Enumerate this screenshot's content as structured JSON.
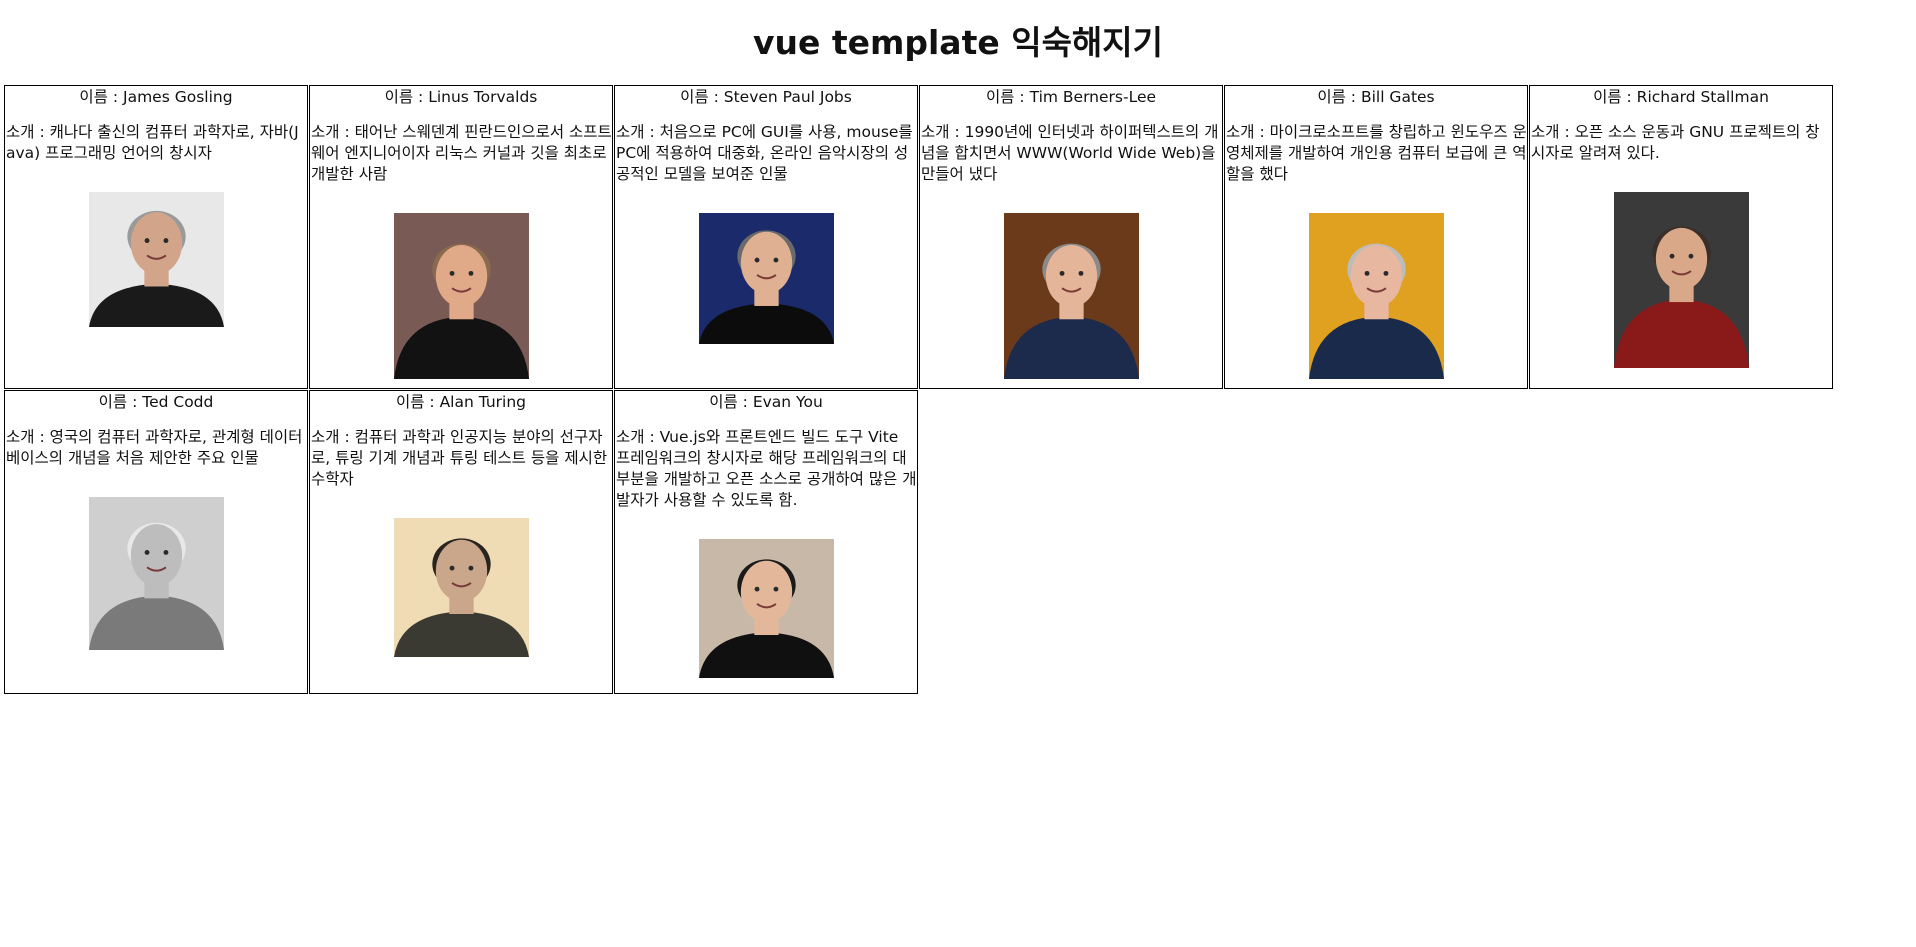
{
  "page": {
    "title": "vue template 익숙해지기"
  },
  "people": [
    {
      "name": "이름 : James Gosling",
      "desc": "소개 : 캐나다 출신의 컴퓨터 과학자로, 자바(Java) 프로그래밍 언어의 창시자",
      "photo": {
        "bg": "#e8e8e8",
        "skin": "#d2a58a",
        "hair": "#9a9a9a",
        "shirt": "#1a1a1a",
        "height_ratio": 1.0
      }
    },
    {
      "name": "이름 : Linus Torvalds",
      "desc": "소개 : 태어난 스웨덴계 핀란드인으로서 소프트웨어 엔지니어이자 리눅스 커널과 깃을 최초로 개발한 사람",
      "photo": {
        "bg": "#7a5a55",
        "skin": "#e0a988",
        "hair": "#8a6a4e",
        "shirt": "#121212",
        "height_ratio": 1.23
      }
    },
    {
      "name": "이름 : Steven Paul Jobs",
      "desc": "소개 : 처음으로 PC에 GUI를 사용, mouse를 PC에 적용하여 대중화, 온라인 음악시장의 성공적인 모델을 보여준 인물",
      "photo": {
        "bg": "#1a2a6a",
        "skin": "#e0b092",
        "hair": "#6a6a6a",
        "shirt": "#0c0c0c",
        "height_ratio": 0.97
      }
    },
    {
      "name": "이름 : Tim Berners-Lee",
      "desc": "소개 : 1990년에 인터넷과 하이퍼텍스트의 개념을 합치면서 WWW(World Wide Web)을 만들어 냈다",
      "photo": {
        "bg": "#6a3a1a",
        "skin": "#e5b59a",
        "hair": "#8a8a8a",
        "shirt": "#1c2a4c",
        "height_ratio": 1.23
      }
    },
    {
      "name": "이름 : Bill Gates",
      "desc": "소개 : 마이크로소프트를 창립하고 윈도우즈 운영체제를 개발하여 개인용 컴퓨터 보급에 큰 역할을 했다",
      "photo": {
        "bg": "#e0a020",
        "skin": "#e7b7a0",
        "hair": "#bcbcbc",
        "shirt": "#1a2a4a",
        "height_ratio": 1.23
      }
    },
    {
      "name": "이름 : Richard Stallman",
      "desc": "소개 : 오픈 소스 운동과 GNU 프로젝트의 창시자로 알려져 있다.",
      "photo": {
        "bg": "#3a3a3a",
        "skin": "#d8a888",
        "hair": "#3a2e28",
        "shirt": "#8a1a1a",
        "height_ratio": 1.3
      }
    },
    {
      "name": "이름 : Ted Codd",
      "desc": "소개 : 영국의 컴퓨터 과학자로, 관계형 데이터베이스의 개념을 처음 제안한 주요 인물",
      "photo": {
        "bg": "#cfcfcf",
        "skin": "#bdbdbd",
        "hair": "#e8e8e8",
        "shirt": "#7a7a7a",
        "height_ratio": 1.13
      }
    },
    {
      "name": "이름 : Alan Turing",
      "desc": "소개 : 컴퓨터 과학과 인공지능 분야의 선구자로, 튜링 기계 개념과 튜링 테스트 등을 제시한 수학자",
      "photo": {
        "bg": "#efdcb4",
        "skin": "#caa68a",
        "hair": "#2a2420",
        "shirt": "#3a3a32",
        "height_ratio": 1.03
      }
    },
    {
      "name": "이름 : Evan You",
      "desc": "소개 : Vue.js와 프론트엔드 빌드 도구 Vite 프레임워크의 창시자로 해당 프레임워크의 대부분을 개발하고 오픈 소스로 공개하여 많은 개발자가 사용할 수 있도록 함.",
      "photo": {
        "bg": "#c8b8a8",
        "skin": "#e3b89a",
        "hair": "#1a1a1a",
        "shirt": "#101010",
        "height_ratio": 1.03
      }
    }
  ]
}
